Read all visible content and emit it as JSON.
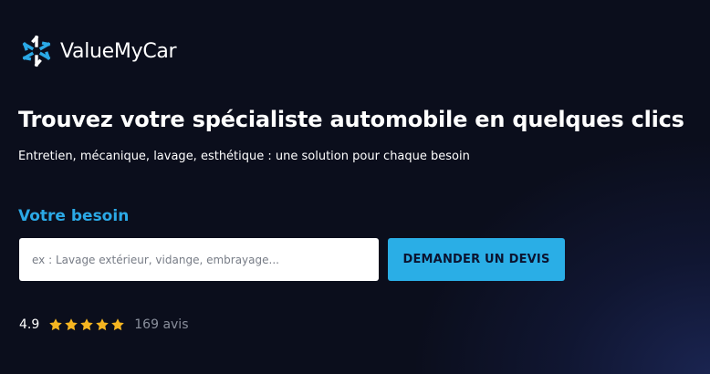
{
  "brand": {
    "name": "ValueMyCar",
    "icon": "snowflake-logo-icon",
    "accent_color": "#2ba9e6"
  },
  "hero": {
    "title": "Trouvez votre spécialiste automobile en quelques clics",
    "subtitle": "Entretien, mécanique, lavage, esthétique : une solution pour chaque besoin"
  },
  "search": {
    "label": "Votre besoin",
    "placeholder": "ex : Lavage extérieur, vidange, embrayage...",
    "value": ""
  },
  "cta": {
    "label": "DEMANDER UN DEVIS",
    "color": "#2aaee6"
  },
  "rating": {
    "score": "4.9",
    "stars": 5,
    "star_color": "#f5b521",
    "count": "169 avis"
  }
}
